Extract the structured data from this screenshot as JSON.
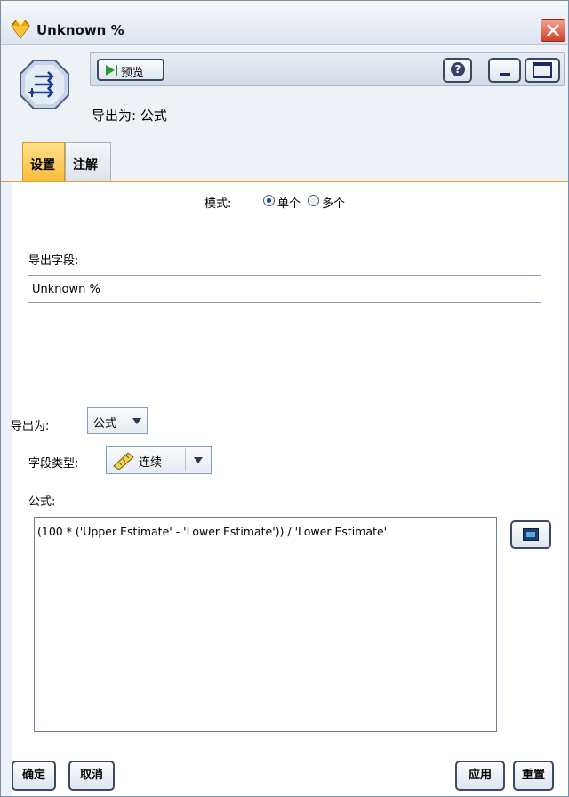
{
  "window": {
    "title": "Unknown %",
    "close_icon": "close-icon"
  },
  "header": {
    "preview_label": "预览",
    "derive_as_caption": "导出为: 公式"
  },
  "tabs": [
    {
      "label": "设置",
      "active": true
    },
    {
      "label": "注解",
      "active": false
    }
  ],
  "settings": {
    "mode_label": "模式:",
    "mode_options": [
      {
        "label": "单个",
        "selected": true
      },
      {
        "label": "多个",
        "selected": false
      }
    ],
    "derive_field_label": "导出字段:",
    "derive_field_value": "Unknown %",
    "derive_as_label": "导出为:",
    "derive_as_value": "公式",
    "field_type_label": "字段类型:",
    "field_type_value": "连续",
    "formula_label": "公式:",
    "formula_value": "(100 * ('Upper Estimate' - 'Lower Estimate')) / 'Lower Estimate'"
  },
  "footer": {
    "ok_label": "确定",
    "cancel_label": "取消",
    "apply_label": "应用",
    "reset_label": "重置"
  },
  "colors": {
    "active_tab": "#f7bc3a",
    "play_green": "#2a9a2e",
    "close_red": "#d1412b"
  }
}
